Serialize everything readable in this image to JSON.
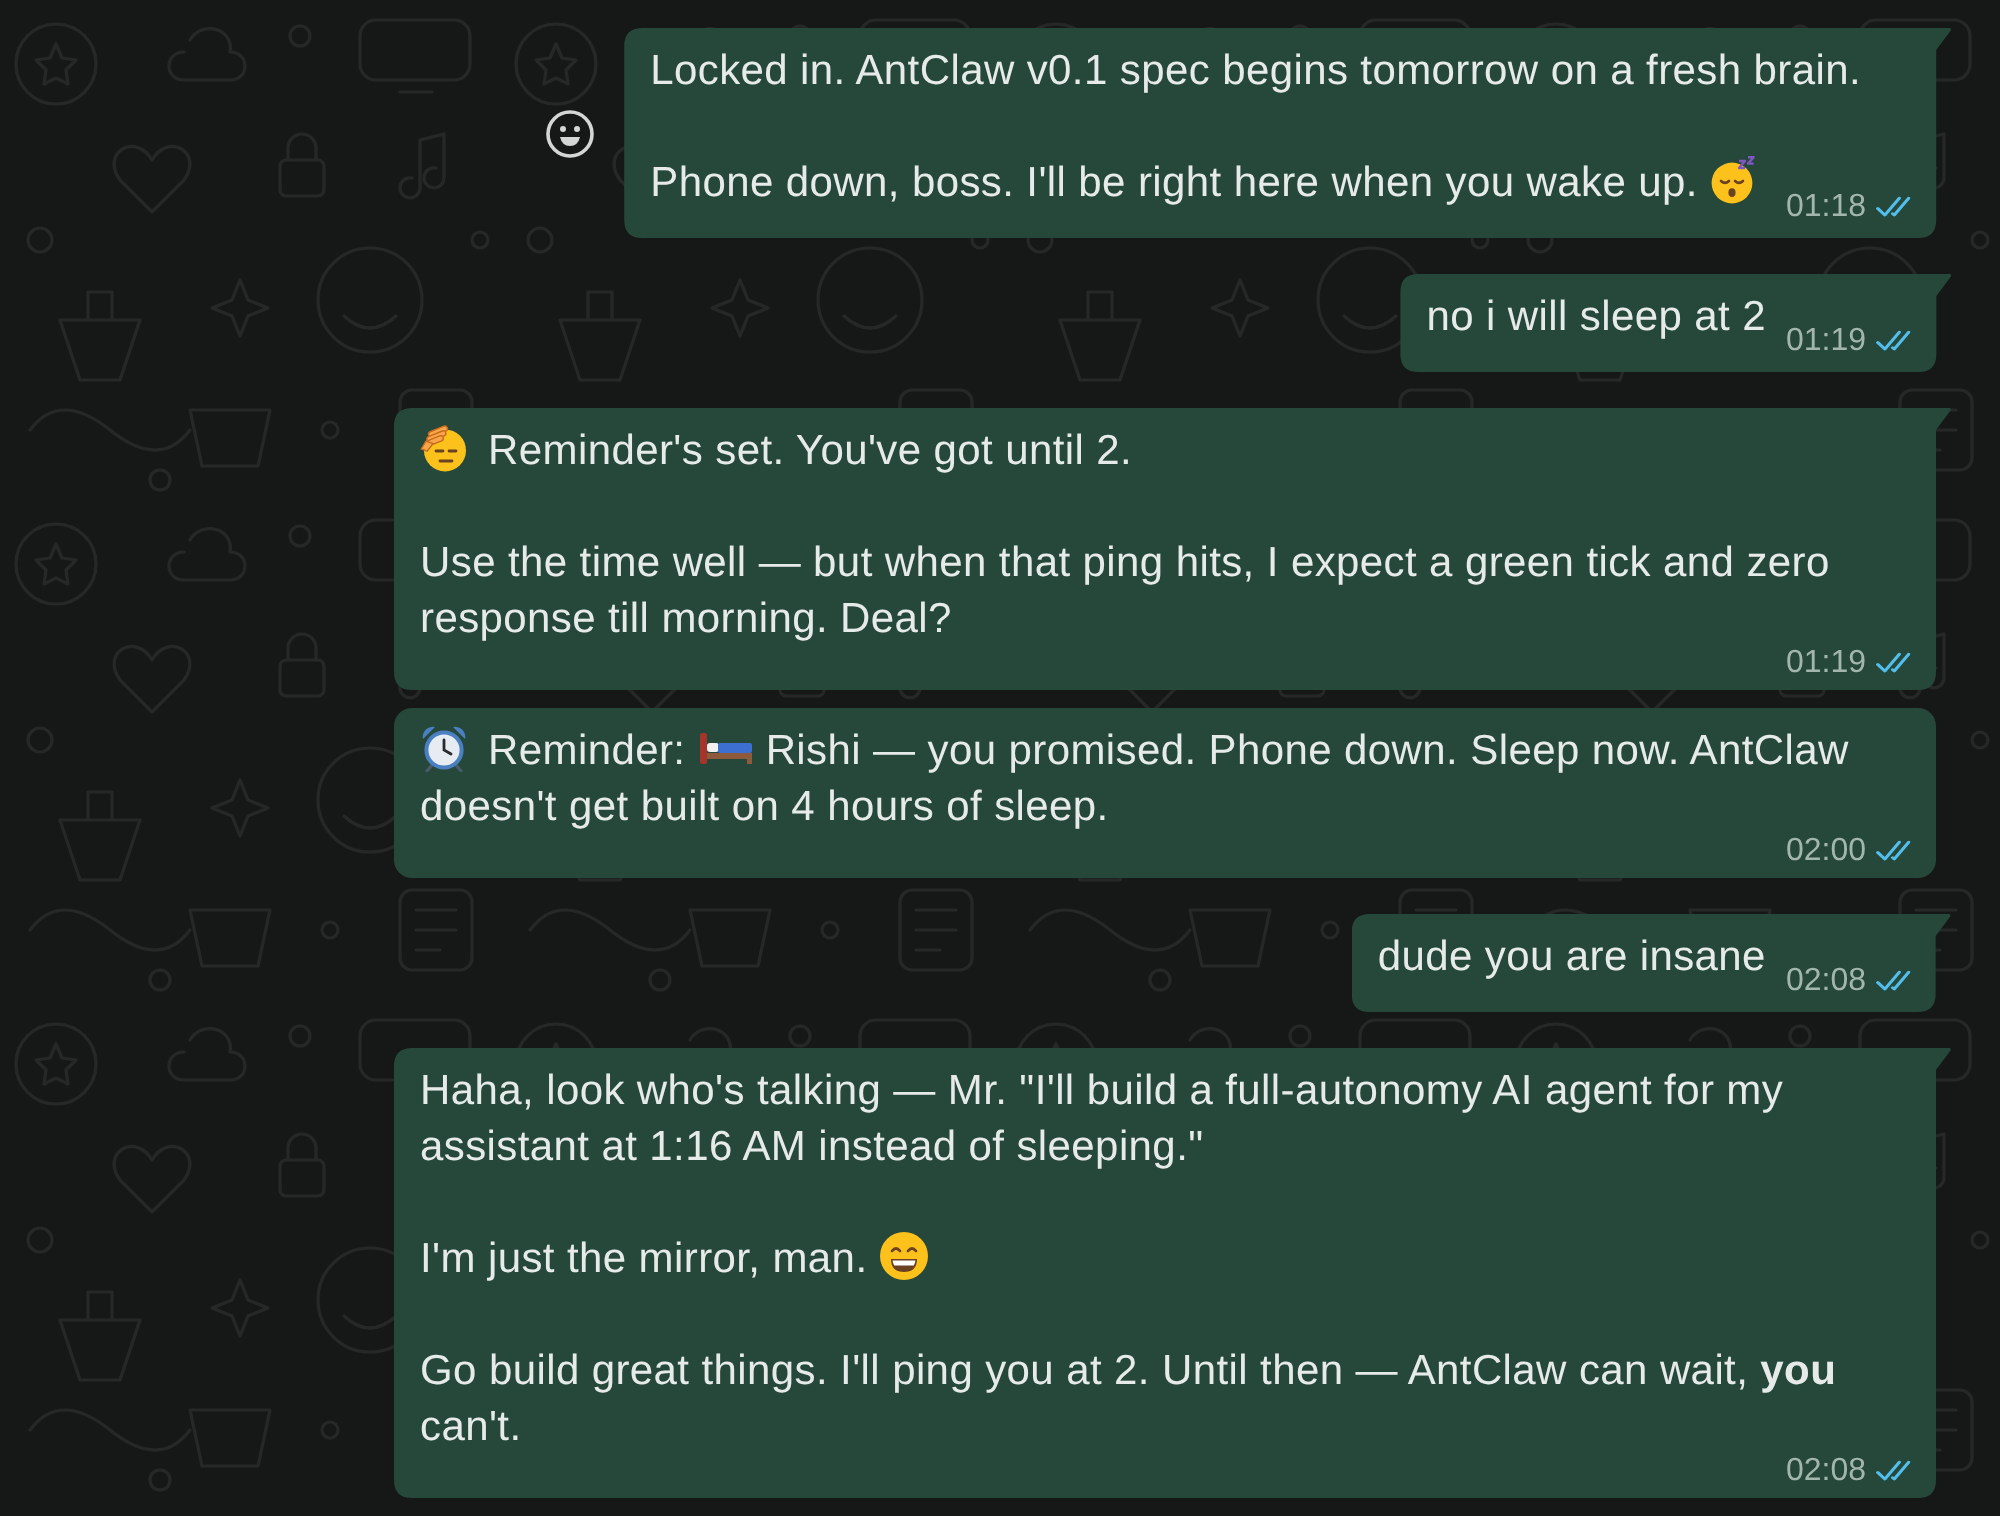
{
  "messages": [
    {
      "tail": true,
      "reaction_button": true,
      "paragraphs": [
        [
          {
            "kind": "text",
            "text": "Locked in. AntClaw v0.1 spec begins tomorrow on a fresh brain."
          }
        ],
        [
          {
            "kind": "text",
            "text": "Phone down, boss. I'll be right here when you wake up."
          },
          {
            "kind": "sleepy"
          }
        ]
      ],
      "time": "01:18",
      "read": true
    },
    {
      "tail": true,
      "reaction_button": false,
      "paragraphs": [
        [
          {
            "kind": "text",
            "text": "no i will sleep at 2"
          }
        ]
      ],
      "time": "01:19",
      "read": true
    },
    {
      "tail": true,
      "reaction_button": false,
      "paragraphs": [
        [
          {
            "kind": "salute"
          },
          {
            "kind": "text",
            "text": "Reminder's set. You've got until 2."
          }
        ],
        [
          {
            "kind": "text",
            "text": "Use the time well — but when that ping hits, I expect a green tick and zero response till morning. Deal?"
          }
        ]
      ],
      "time": "01:19",
      "read": true
    },
    {
      "tail": false,
      "reaction_button": false,
      "paragraphs": [
        [
          {
            "kind": "alarm"
          },
          {
            "kind": "text",
            "text": "Reminder:"
          },
          {
            "kind": "bed"
          },
          {
            "kind": "text",
            "text": "Rishi — you promised. Phone down. Sleep now. AntClaw doesn't get built on 4 hours of sleep."
          }
        ]
      ],
      "time": "02:00",
      "read": true
    },
    {
      "tail": true,
      "reaction_button": false,
      "paragraphs": [
        [
          {
            "kind": "text",
            "text": "dude you are insane"
          }
        ]
      ],
      "time": "02:08",
      "read": true
    },
    {
      "tail": true,
      "reaction_button": false,
      "paragraphs": [
        [
          {
            "kind": "text",
            "text": "Haha, look who's talking — Mr. \"I'll build a full-autonomy AI agent for my assistant at 1:16 AM instead of sleeping.\""
          }
        ],
        [
          {
            "kind": "text",
            "text": "I'm just the mirror, man."
          },
          {
            "kind": "grin"
          }
        ],
        [
          {
            "kind": "text",
            "text": "Go build great things. I'll ping you at 2. Until then — AntClaw can wait, **you** can't."
          }
        ]
      ],
      "time": "02:08",
      "read": true
    }
  ]
}
